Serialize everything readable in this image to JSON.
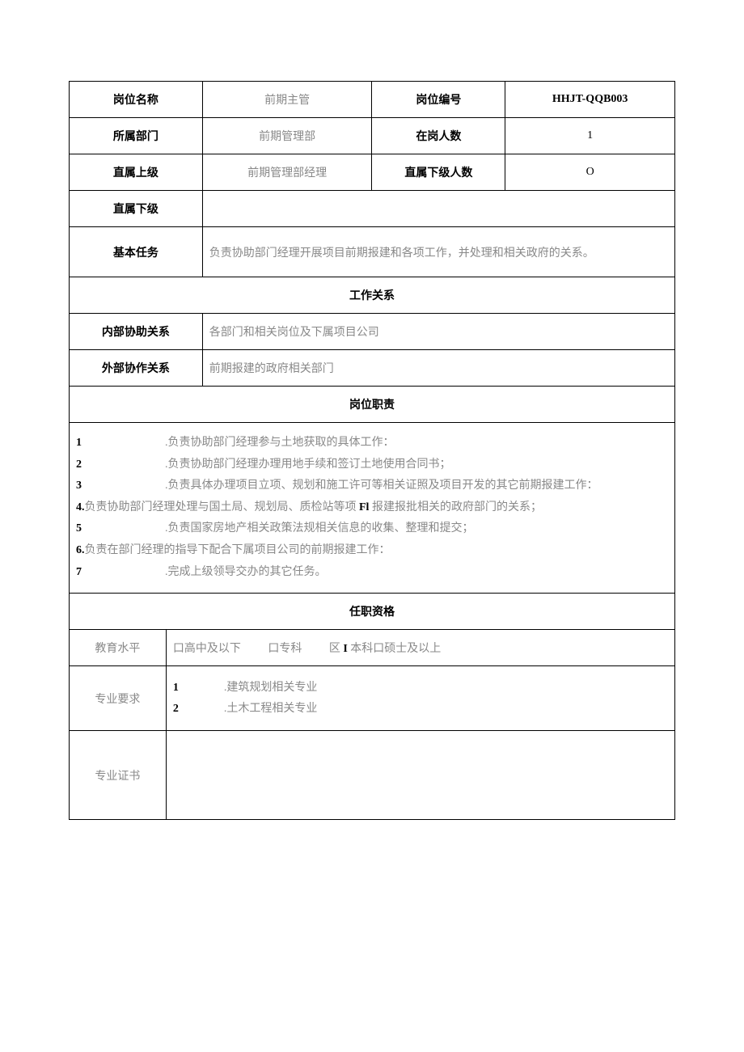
{
  "header": {
    "position_name_label": "岗位名称",
    "position_name_value": "前期主管",
    "position_code_label": "岗位编号",
    "position_code_value": "HHJT-QQB003",
    "department_label": "所属部门",
    "department_value": "前期管理部",
    "headcount_label": "在岗人数",
    "headcount_value": "1",
    "supervisor_label": "直属上级",
    "supervisor_value": "前期管理部经理",
    "subordinate_count_label": "直属下级人数",
    "subordinate_count_value": "O",
    "subordinate_label": "直属下级",
    "subordinate_value": "",
    "basic_task_label": "基本任务",
    "basic_task_value": "负责协助部门经理开展项目前期报建和各项工作，并处理和相关政府的关系。"
  },
  "relations": {
    "section": "工作关系",
    "internal_label": "内部协助关系",
    "internal_value": "各部门和相关岗位及下属项目公司",
    "external_label": "外部协作关系",
    "external_value": "前期报建的政府相关部门"
  },
  "responsibilities": {
    "section": "岗位职责",
    "items": [
      {
        "num": "1",
        "indent": true,
        "text": ".负责协助部门经理参与土地获取的具体工作："
      },
      {
        "num": "2",
        "indent": true,
        "text": ".负责协助部门经理办理用地手续和签订土地使用合同书；"
      },
      {
        "num": "3",
        "indent": true,
        "text": ".负责具体办理项目立项、规划和施工许可等相关证照及项目开发的其它前期报建工作："
      },
      {
        "num": "4.",
        "indent": false,
        "prefix": "负责协助部门经理处理与国土局、规划局、质检站等项 ",
        "bold": "Fl",
        "suffix": " 报建报批相关的政府部门的关系；"
      },
      {
        "num": "5",
        "indent": true,
        "text": ".负责国家房地产相关政策法规相关信息的收集、整理和提交；"
      },
      {
        "num": "6.",
        "indent": false,
        "text": "负责在部门经理的指导下配合下属项目公司的前期报建工作："
      },
      {
        "num": "7",
        "indent": true,
        "text": ".完成上级领导交办的其它任务。"
      }
    ]
  },
  "qualifications": {
    "section": "任职资格",
    "education_label": "教育水平",
    "education_options": {
      "opt1": "口高中及以下",
      "opt2": "口专科",
      "opt3_prefix": "区 ",
      "opt3_bold": "I",
      "opt3_suffix": " 本科口硕士及以上"
    },
    "major_label": "专业要求",
    "majors": [
      {
        "num": "1",
        "text": ".建筑规划相关专业"
      },
      {
        "num": "2",
        "text": ".土木工程相关专业"
      }
    ],
    "cert_label": "专业证书",
    "cert_value": ""
  }
}
